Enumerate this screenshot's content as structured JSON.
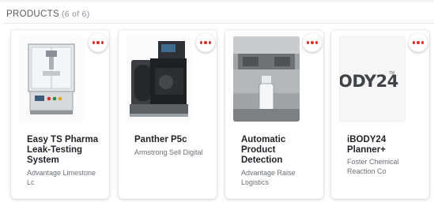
{
  "section": {
    "title": "PRODUCTS",
    "count": "(6 of 6)"
  },
  "colors": {
    "accent_dots": "#d9342b",
    "title_text": "#1f2328",
    "muted_text": "#6b7178"
  },
  "products": [
    {
      "title": "Easy TS Pharma Leak-Testing System",
      "vendor": "Advantage Limestone Lc",
      "image": "leak-testing-machine-photo"
    },
    {
      "title": "Panther P5c",
      "vendor": "Armstrong Sell Digital",
      "image": "industrial-printer-photo"
    },
    {
      "title": "Automatic Product Detection",
      "vendor": "Advantage Raise Logistics",
      "image": "bottle-detection-photo"
    },
    {
      "title": "iBODY24 Planner+",
      "vendor": "Foster Chemical Reaction Co",
      "image": "ibody24-logo",
      "logo_text": "ODY24",
      "logo_sub": "TM"
    }
  ]
}
